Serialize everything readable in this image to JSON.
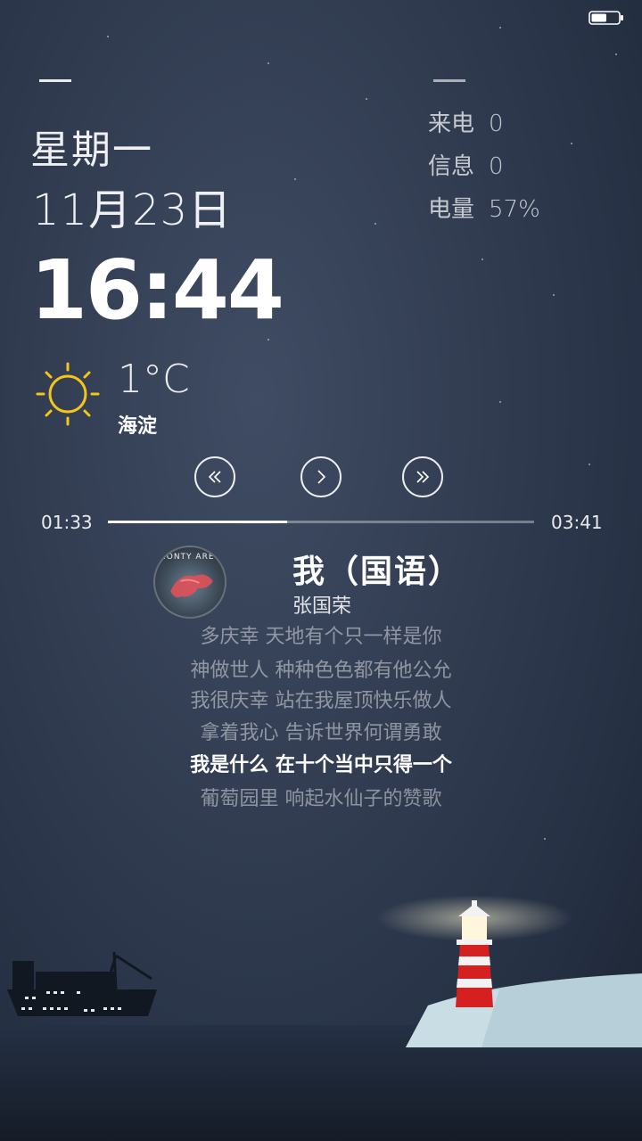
{
  "status_bar": {
    "battery_icon": "battery-icon",
    "battery_level": 0.57
  },
  "clock": {
    "weekday": "星期一",
    "date": "11月23日",
    "time": "16:44"
  },
  "stats": {
    "calls_label": "来电",
    "calls_value": "0",
    "messages_label": "信息",
    "messages_value": "0",
    "battery_label": "电量",
    "battery_value": "57%"
  },
  "weather": {
    "icon": "sun-icon",
    "temperature": "1°C",
    "location": "海淀",
    "icon_color": "#f5c518"
  },
  "player": {
    "controls": [
      "prev-icon",
      "play-icon",
      "next-icon"
    ],
    "elapsed": "01:33",
    "duration": "03:41",
    "progress": 0.42,
    "album_text": "MONTY ARE I",
    "title": "我（国语）",
    "artist": "张国荣"
  },
  "lyrics": {
    "lines": [
      "多庆幸 天地有个只一样是你",
      "神做世人 种种色色都有他公允",
      "我很庆幸 站在我屋顶快乐做人",
      "拿着我心 告诉世界何谓勇敢",
      "我是什么 在十个当中只得一个",
      "葡萄园里 响起水仙子的赞歌"
    ],
    "active_index": 4
  },
  "scene": {
    "ship_icon": "ship-icon",
    "lighthouse_icon": "lighthouse-icon"
  }
}
